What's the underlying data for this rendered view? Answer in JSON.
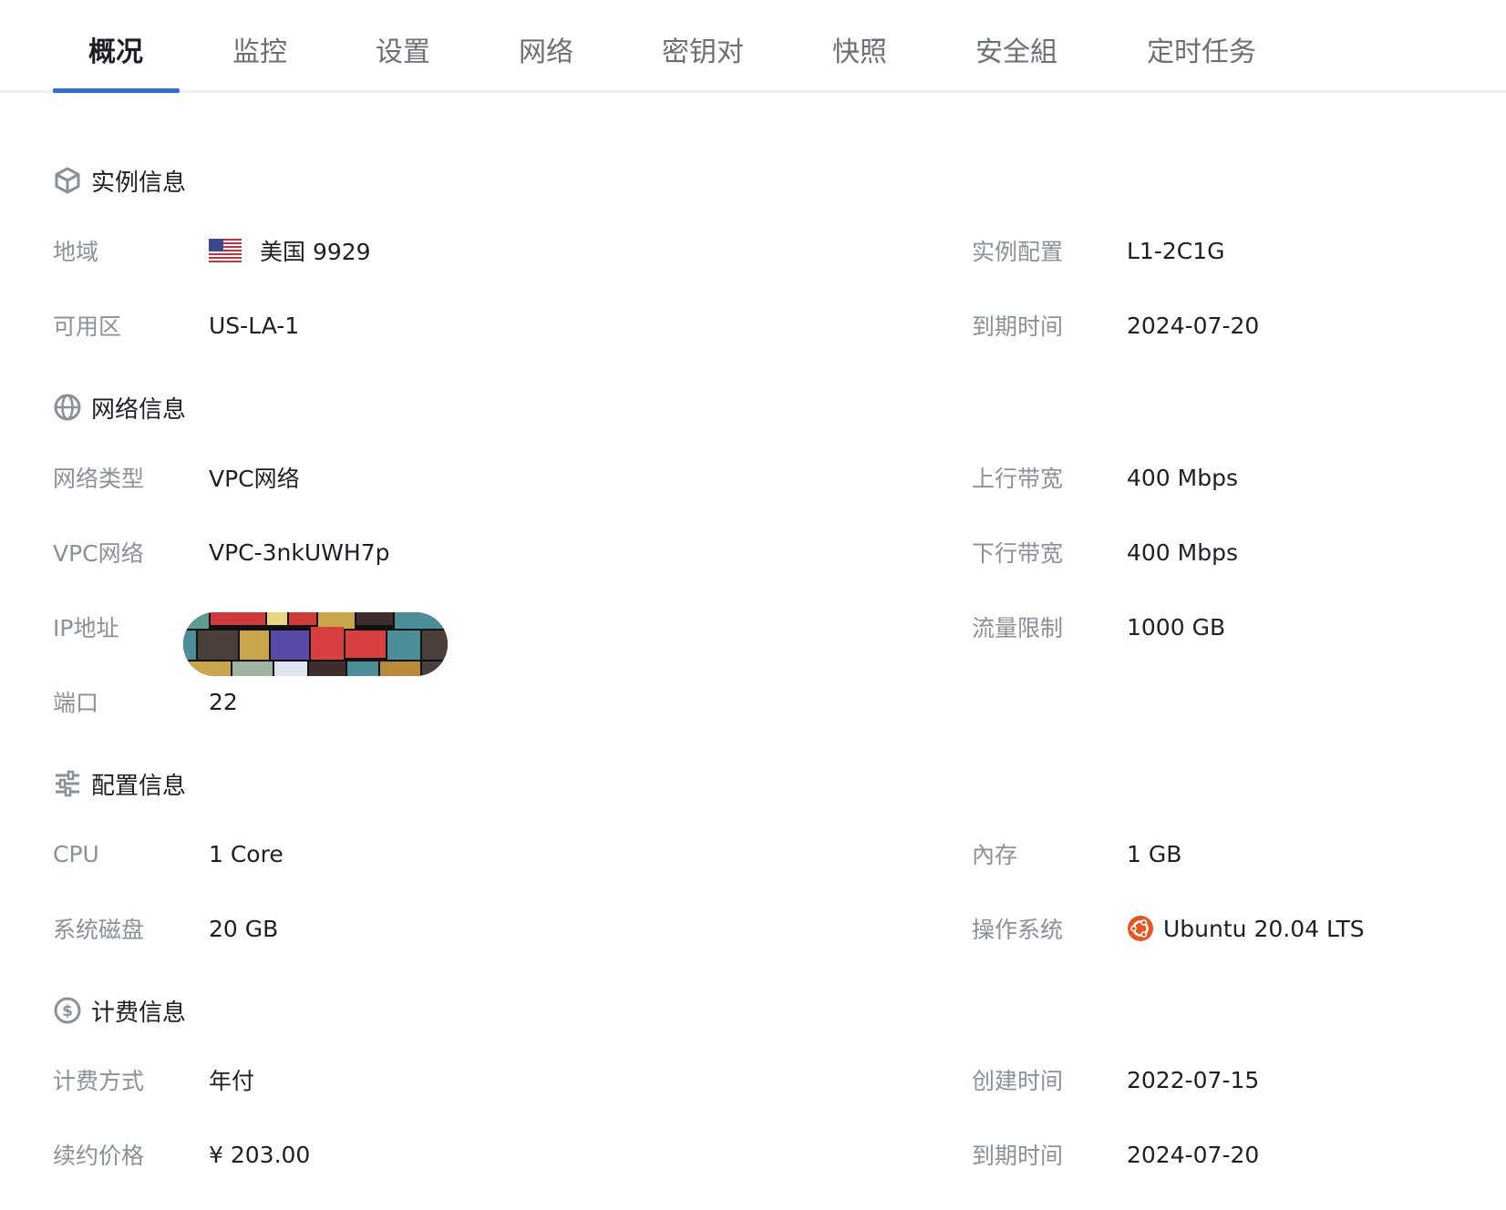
{
  "tabs": [
    {
      "label": "概况",
      "active": true
    },
    {
      "label": "监控",
      "active": false
    },
    {
      "label": "设置",
      "active": false
    },
    {
      "label": "网络",
      "active": false
    },
    {
      "label": "密钥对",
      "active": false
    },
    {
      "label": "快照",
      "active": false
    },
    {
      "label": "安全組",
      "active": false
    },
    {
      "label": "定时任务",
      "active": false
    }
  ],
  "colors": {
    "accent": "#2a6fdb",
    "label": "#8c9097",
    "text": "#1d1f24",
    "ubuntu": "#e95420"
  },
  "instance": {
    "title": "实例信息",
    "icon": "cube-icon",
    "region_label": "地域",
    "region_value": "美国 9929",
    "region_flag": "us-flag-icon",
    "zone_label": "可用区",
    "zone_value": "US-LA-1",
    "spec_label": "实例配置",
    "spec_value": "L1-2C1G",
    "expire_label": "到期时间",
    "expire_value": "2024-07-20"
  },
  "network": {
    "title": "网络信息",
    "icon": "globe-icon",
    "type_label": "网络类型",
    "type_value": "VPC网络",
    "vpc_label": "VPC网络",
    "vpc_value": "VPC-3nkUWH7p",
    "ip_label": "IP地址",
    "port_label": "端口",
    "port_value": "22",
    "up_label": "上行带宽",
    "up_value": "400 Mbps",
    "down_label": "下行带宽",
    "down_value": "400 Mbps",
    "traffic_label": "流量限制",
    "traffic_value": "1000 GB"
  },
  "config": {
    "title": "配置信息",
    "icon": "sliders-icon",
    "cpu_label": "CPU",
    "cpu_value": "1 Core",
    "disk_label": "系统磁盘",
    "disk_value": "20 GB",
    "mem_label": "內存",
    "mem_value": "1 GB",
    "os_label": "操作系统",
    "os_value": "Ubuntu 20.04 LTS",
    "os_icon": "ubuntu-icon"
  },
  "billing": {
    "title": "计费信息",
    "icon": "dollar-coin-icon",
    "method_label": "计费方式",
    "method_value": "年付",
    "renew_label": "续约价格",
    "renew_value": "¥ 203.00",
    "created_label": "创建时间",
    "created_value": "2022-07-15",
    "expire_label": "到期时间",
    "expire_value": "2024-07-20"
  }
}
